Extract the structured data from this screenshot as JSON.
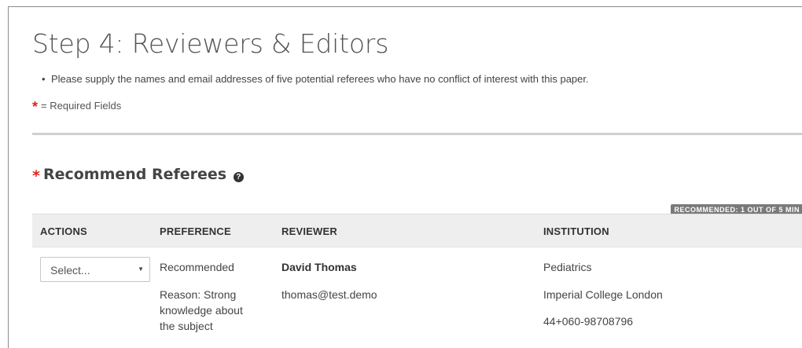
{
  "page": {
    "title": "Step 4: Reviewers & Editors",
    "instructions": [
      "Please supply the names and email addresses of five potential referees who have no conflict of interest with this paper."
    ],
    "required_star": "*",
    "required_label": "= Required Fields"
  },
  "section": {
    "star": "*",
    "title": "Recommend Referees",
    "help_icon": "question-circle-icon",
    "help_glyph": "?",
    "badge": "RECOMMENDED: 1 OUT OF 5 MIN"
  },
  "table": {
    "headers": {
      "actions": "ACTIONS",
      "preference": "PREFERENCE",
      "reviewer": "REVIEWER",
      "institution": "INSTITUTION"
    },
    "rows": [
      {
        "action_select": "Select...",
        "caret": "▼",
        "preference": "Recommended",
        "reason_lines": [
          "Reason: Strong",
          "knowledge about",
          "the subject"
        ],
        "reviewer_name": "David Thomas",
        "reviewer_email": "thomas@test.demo",
        "department": "Pediatrics",
        "institution": "Imperial College London",
        "phone": "44+060-98708796"
      }
    ]
  },
  "colors": {
    "required_star": "#e2231a",
    "header_bg": "#eeeeee",
    "badge_bg": "#7a7a7a"
  }
}
